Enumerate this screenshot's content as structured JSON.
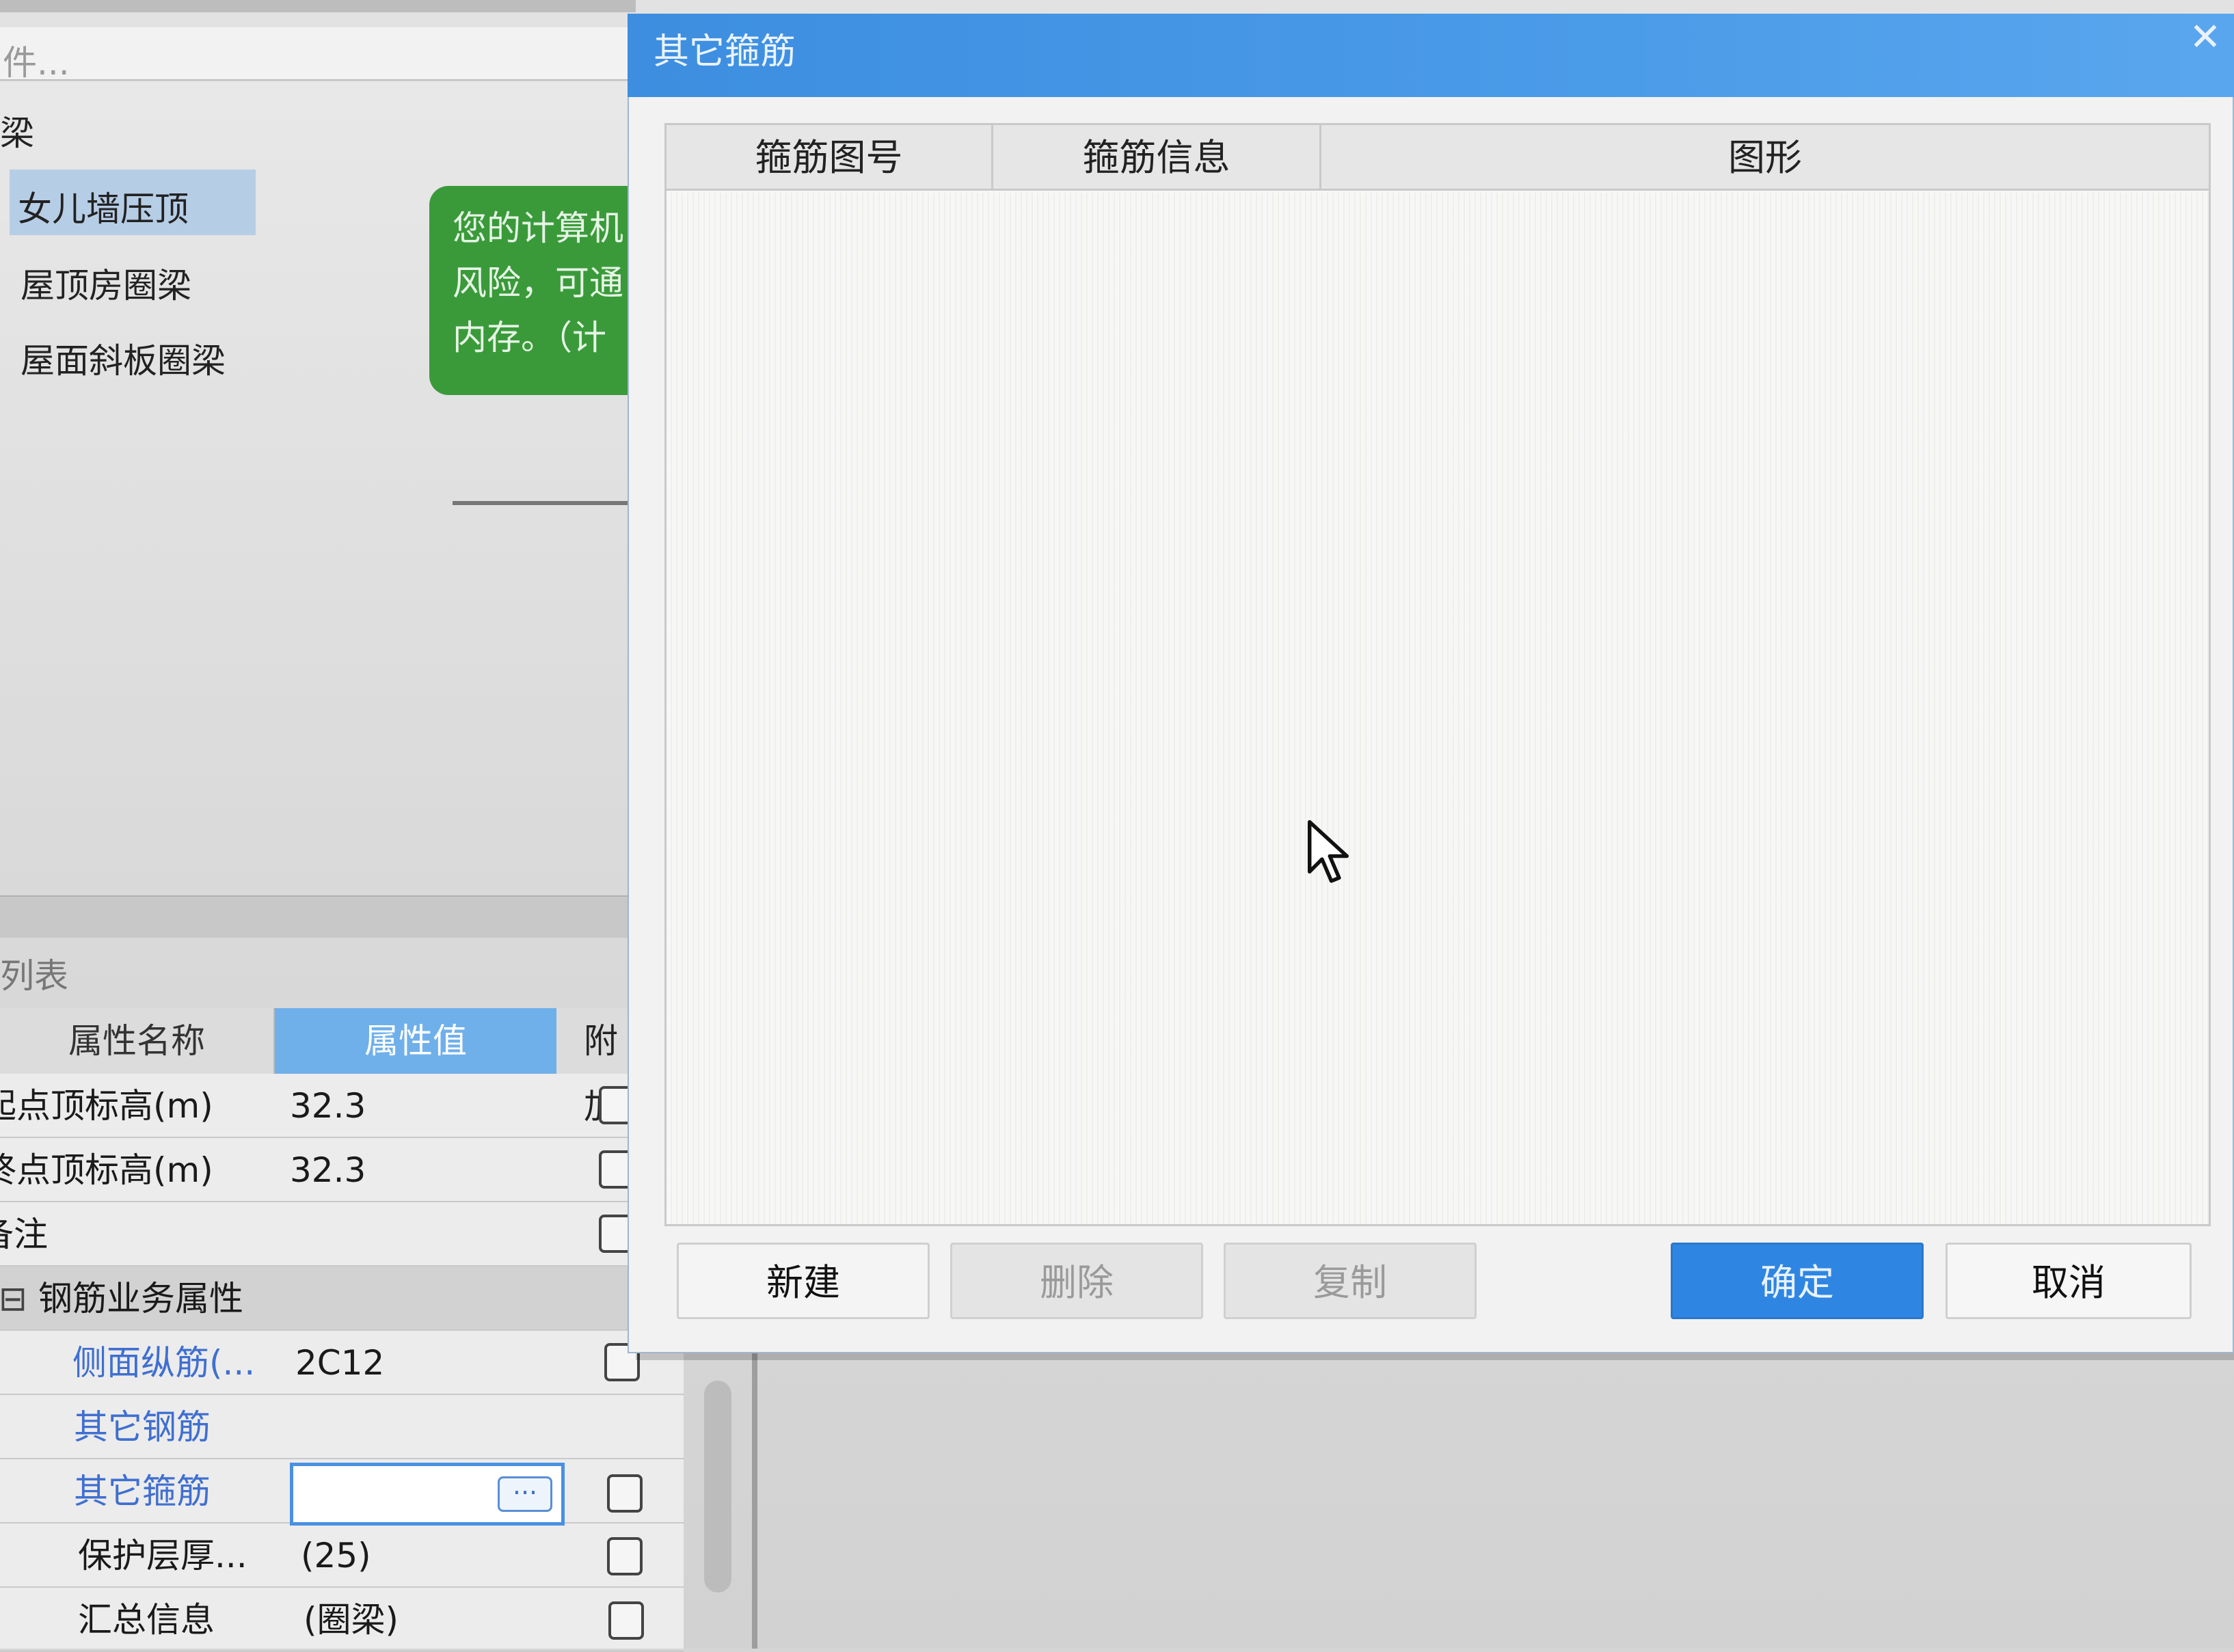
{
  "background": {
    "search_placeholder": "件...",
    "tree": {
      "root": "梁",
      "items": [
        "女儿墙压顶",
        "屋顶房圈梁",
        "屋面斜板圈梁"
      ],
      "selected_index": 0
    },
    "tip_lines": [
      "您的计算机",
      "风险，可通",
      "内存。（计"
    ],
    "list_title": "列表",
    "property_grid": {
      "headers": {
        "name": "属性名称",
        "value": "属性值",
        "extra": "附加"
      },
      "rows": [
        {
          "name": "起点顶标高(m)",
          "value": "32.3"
        },
        {
          "name": "终点顶标高(m)",
          "value": "32.3"
        },
        {
          "name": "备注",
          "value": ""
        },
        {
          "name": "钢筋业务属性",
          "value": "",
          "group": true,
          "toggle": "⊟"
        },
        {
          "name": "侧面纵筋(...",
          "value": "2C12"
        },
        {
          "name": "其它钢筋",
          "value": ""
        },
        {
          "name": "其它箍筋",
          "value": ""
        },
        {
          "name": "保护层厚...",
          "value": "(25)"
        },
        {
          "name": "汇总信息",
          "value": "(圈梁)"
        }
      ],
      "ellipsis": "···"
    }
  },
  "dialog": {
    "title": "其它箍筋",
    "close_glyph": "✕",
    "columns": [
      "箍筋图号",
      "箍筋信息",
      "图形"
    ],
    "rows": [],
    "buttons": {
      "new": "新建",
      "delete": "删除",
      "copy": "复制",
      "ok": "确定",
      "cancel": "取消"
    }
  },
  "colors": {
    "title_bar": "#3d8ee0",
    "ok_button": "#2f86e2",
    "value_header": "#6fb0ea",
    "tip_green": "#3a9a3a"
  },
  "icons": [
    "close-icon",
    "ellipsis-icon",
    "collapse-icon",
    "mouse-cursor-icon"
  ]
}
